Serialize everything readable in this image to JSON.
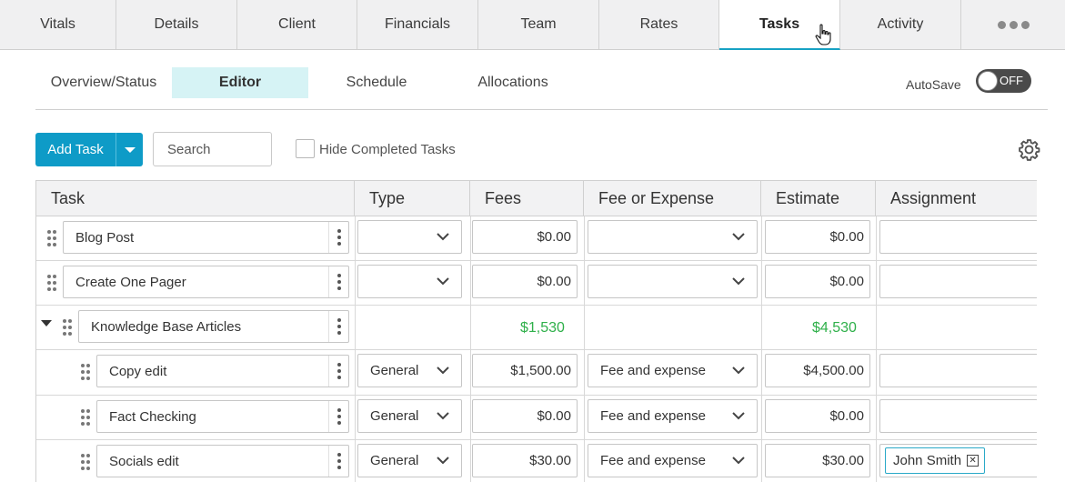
{
  "top_tabs": [
    {
      "label": "Vitals"
    },
    {
      "label": "Details"
    },
    {
      "label": "Client"
    },
    {
      "label": "Financials"
    },
    {
      "label": "Team"
    },
    {
      "label": "Rates"
    },
    {
      "label": "Tasks",
      "active": true
    },
    {
      "label": "Activity"
    }
  ],
  "more_icon": "more-horizontal-icon",
  "sub_tabs": [
    {
      "label": "Overview/Status"
    },
    {
      "label": "Editor",
      "active": true
    },
    {
      "label": "Schedule"
    },
    {
      "label": "Allocations"
    }
  ],
  "autosave": {
    "label": "AutoSave",
    "state": "OFF"
  },
  "toolbar": {
    "add_task_label": "Add Task",
    "search_placeholder": "Search",
    "hide_completed_label": "Hide Completed Tasks",
    "hide_completed_checked": false,
    "settings_icon": "gear-icon"
  },
  "colors": {
    "accent": "#0e9bc7",
    "active_tab_underline": "#17a2c4",
    "editor_tab_bg": "#d6f3f5",
    "green_total": "#2fb04a"
  },
  "table": {
    "columns": [
      "Task",
      "Type",
      "Fees",
      "Fee or Expense",
      "Estimate",
      "Assignment"
    ],
    "rows": [
      {
        "task": "Blog Post",
        "type": "",
        "fees": "$0.00",
        "fee_or_expense": "",
        "estimate": "$0.00",
        "assignment": ""
      },
      {
        "task": "Create One Pager",
        "type": "",
        "fees": "$0.00",
        "fee_or_expense": "",
        "estimate": "$0.00",
        "assignment": ""
      },
      {
        "task": "Knowledge Base Articles",
        "group": true,
        "fees_total": "$1,530",
        "estimate_total": "$4,530"
      },
      {
        "task": "Copy edit",
        "type": "General",
        "fees": "$1,500.00",
        "fee_or_expense": "Fee and expense",
        "estimate": "$4,500.00",
        "assignment": ""
      },
      {
        "task": "Fact Checking",
        "type": "General",
        "fees": "$0.00",
        "fee_or_expense": "Fee and expense",
        "estimate": "$0.00",
        "assignment": ""
      },
      {
        "task": "Socials edit",
        "type": "General",
        "fees": "$30.00",
        "fee_or_expense": "Fee and expense",
        "estimate": "$30.00",
        "assignment": "John Smith"
      }
    ]
  }
}
